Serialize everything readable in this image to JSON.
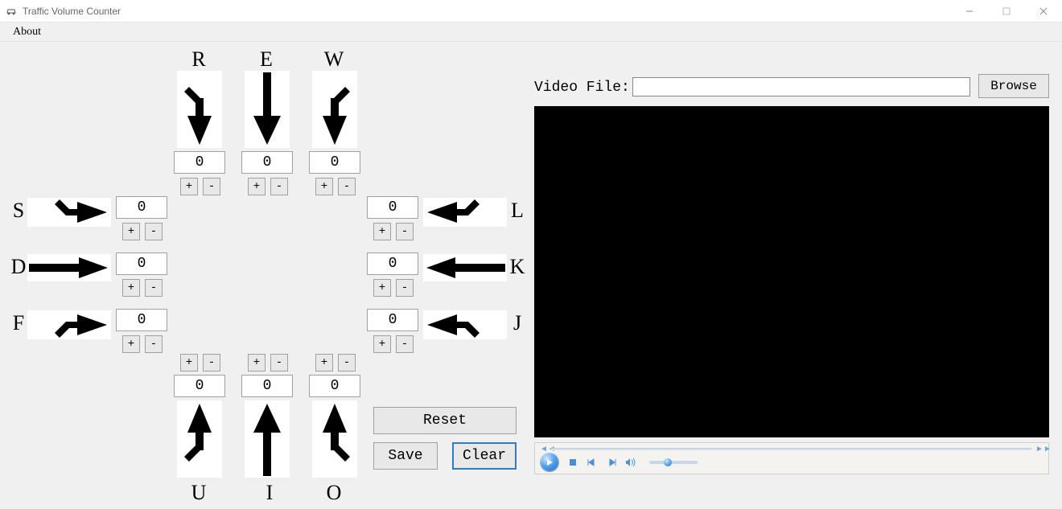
{
  "window": {
    "title": "Traffic Volume Counter",
    "menu": {
      "about": "About"
    },
    "controls": {
      "min": "—",
      "max": "▢",
      "close": "✕"
    }
  },
  "plusLabel": "+",
  "minusLabel": "-",
  "counters": {
    "top": {
      "R": {
        "key": "R",
        "value": 0
      },
      "E": {
        "key": "E",
        "value": 0
      },
      "W": {
        "key": "W",
        "value": 0
      }
    },
    "left": {
      "S": {
        "key": "S",
        "value": 0
      },
      "D": {
        "key": "D",
        "value": 0
      },
      "F": {
        "key": "F",
        "value": 0
      }
    },
    "right": {
      "L": {
        "key": "L",
        "value": 0
      },
      "K": {
        "key": "K",
        "value": 0
      },
      "J": {
        "key": "J",
        "value": 0
      }
    },
    "bottom": {
      "U": {
        "key": "U",
        "value": 0
      },
      "I": {
        "key": "I",
        "value": 0
      },
      "O": {
        "key": "O",
        "value": 0
      }
    }
  },
  "buttons": {
    "reset": "Reset",
    "save": "Save",
    "clear": "Clear",
    "browse": "Browse"
  },
  "video": {
    "label": "Video File:",
    "path": ""
  }
}
